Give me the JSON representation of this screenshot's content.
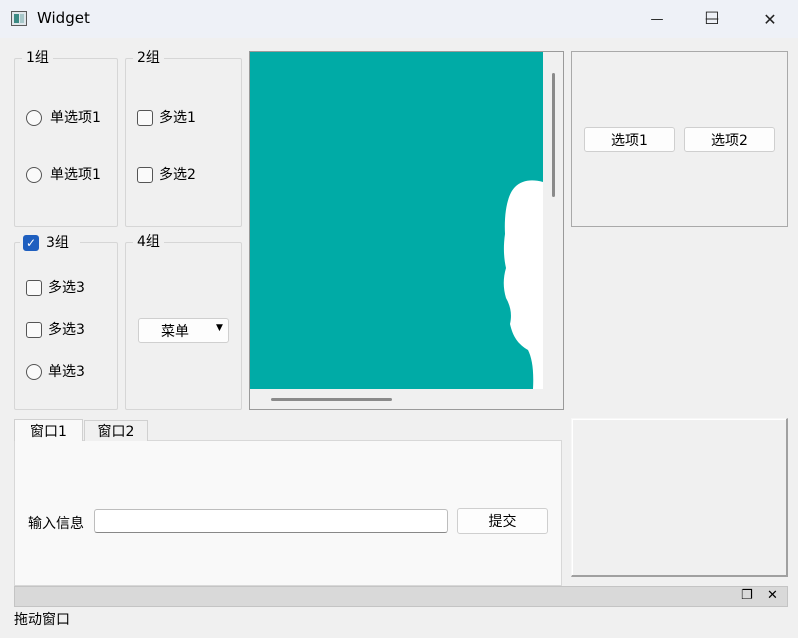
{
  "window": {
    "title": "Widget",
    "controls": {
      "minimize": "—",
      "maximize": "☐",
      "close": "✕"
    },
    "icon": "app-window-icon"
  },
  "groups": {
    "group1": {
      "title": "1组",
      "options": [
        {
          "type": "radio",
          "label": "单选项1",
          "checked": false
        },
        {
          "type": "radio",
          "label": "单选项1",
          "checked": false
        }
      ]
    },
    "group2": {
      "title": "2组",
      "options": [
        {
          "type": "checkbox",
          "label": "多选1",
          "checked": false
        },
        {
          "type": "checkbox",
          "label": "多选2",
          "checked": false
        }
      ]
    },
    "group3": {
      "title": "3组",
      "title_checked": true,
      "options": [
        {
          "type": "checkbox",
          "label": "多选3",
          "checked": false
        },
        {
          "type": "checkbox",
          "label": "多选3",
          "checked": false
        },
        {
          "type": "radio",
          "label": "单选3",
          "checked": false
        }
      ]
    },
    "group4": {
      "title": "4组",
      "menu_button_label": "菜单"
    }
  },
  "image_view": {
    "background_color": "#00aba6",
    "silhouette_color": "#ffffff"
  },
  "options_panel": {
    "button1": "选项1",
    "button2": "选项2"
  },
  "tabs": {
    "items": [
      {
        "label": "窗口1",
        "active": true
      },
      {
        "label": "窗口2",
        "active": false
      }
    ],
    "panel": {
      "input_label": "输入信息",
      "input_value": "",
      "input_placeholder": "",
      "submit_label": "提交"
    }
  },
  "dock": {
    "title": "拖动窗口",
    "float_icon": "❐",
    "close_icon": "✕"
  },
  "colors": {
    "accent": "#1f5fbf",
    "window_bg": "#f0f0f0",
    "titlebar_bg": "#eef1f7"
  }
}
